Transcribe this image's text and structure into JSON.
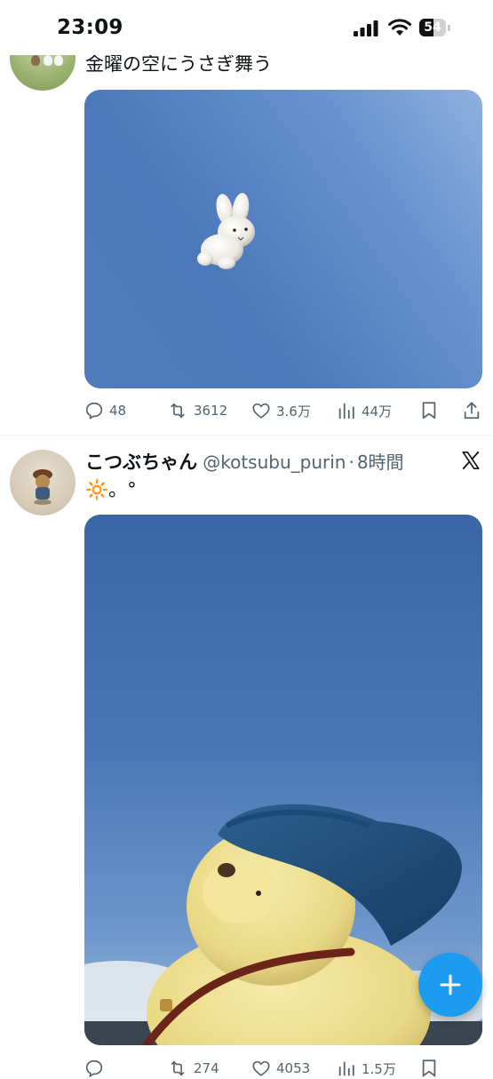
{
  "status_bar": {
    "time": "23:09",
    "battery_percent": "54"
  },
  "tweet1": {
    "text": "金曜の空にうさぎ舞う",
    "metrics": {
      "replies": "48",
      "retweets": "3612",
      "likes": "3.6万",
      "views": "44万"
    }
  },
  "tweet2": {
    "display_name": "こつぶちゃん",
    "handle": "@kotsubu_purin",
    "separator": "·",
    "time": "8時間",
    "text": "🔆。°",
    "metrics": {
      "replies": "",
      "retweets": "274",
      "likes": "4053",
      "views": "1.5万"
    }
  },
  "colors": {
    "accent": "#1d9bf0",
    "secondary_text": "#536471",
    "primary_text": "#0f1419"
  }
}
